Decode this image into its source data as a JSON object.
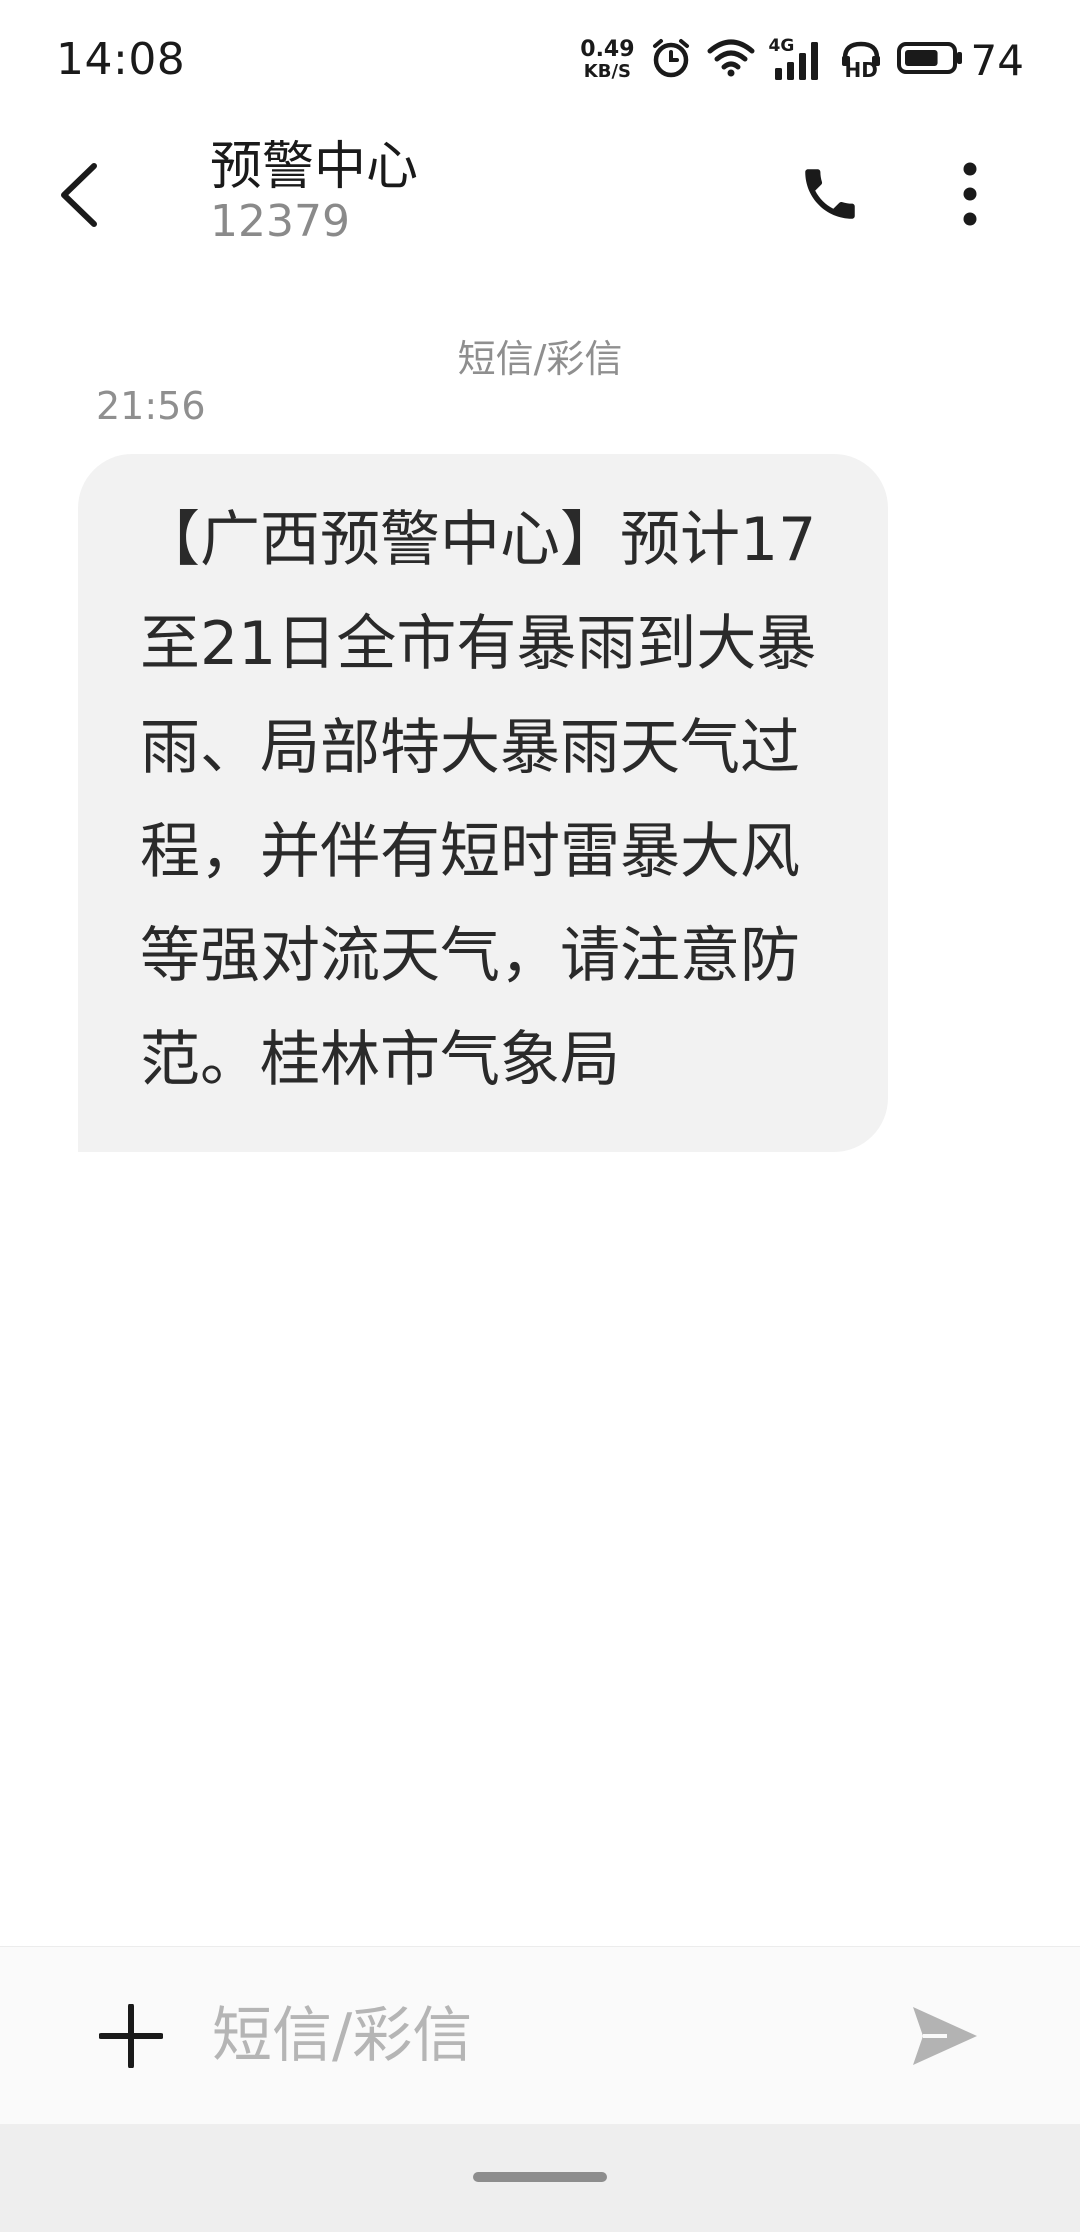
{
  "status_bar": {
    "time": "14:08",
    "net_speed_value": "0.49",
    "net_speed_unit": "KB/S",
    "network_type": "4G",
    "hd_label": "HD",
    "battery_percent": "74",
    "battery_level": 0.74,
    "icons": [
      "alarm-icon",
      "wifi-icon",
      "cellular-signal-icon",
      "hd-voice-icon",
      "battery-icon"
    ]
  },
  "header": {
    "contact_name": "预警中心",
    "contact_number": "12379",
    "icons": [
      "back-arrow-icon",
      "phone-icon",
      "more-vertical-icon"
    ]
  },
  "conversation": {
    "channel_label": "短信/彩信",
    "messages": [
      {
        "time": "21:56",
        "text": "【广西预警中心】预计17至21日全市有暴雨到大暴雨、局部特大暴雨天气过程，并伴有短时雷暴大风等强对流天气，请注意防范。桂林市气象局"
      }
    ]
  },
  "composer": {
    "placeholder": "短信/彩信",
    "value": "",
    "icons": [
      "plus-icon",
      "send-icon"
    ]
  },
  "colors": {
    "bubble_background": "#f2f2f2",
    "secondary_text": "#8f8f8f",
    "send_icon": "#b3b3b3"
  }
}
